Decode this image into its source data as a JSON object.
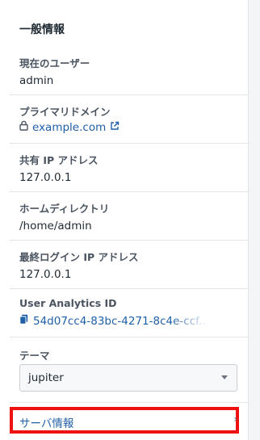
{
  "general": {
    "title": "一般情報",
    "current_user": {
      "label": "現在のユーザー",
      "value": "admin"
    },
    "primary_domain": {
      "label": "プライマリドメイン",
      "value": "example.com"
    },
    "shared_ip": {
      "label": "共有 IP アドレス",
      "value": "127.0.0.1"
    },
    "home_dir": {
      "label": "ホームディレクトリ",
      "value": "/home/admin"
    },
    "last_login_ip": {
      "label": "最終ログイン IP アドレス",
      "value": "127.0.0.1"
    },
    "analytics_id": {
      "label": "User Analytics ID",
      "value": "54d07cc4-83bc-4271-8c4e-ccf..."
    }
  },
  "theme": {
    "label": "テーマ",
    "selected": "jupiter"
  },
  "server_info": {
    "label": "サーバ情報"
  },
  "colors": {
    "link": "#1f5fa8",
    "highlight": "#ee1111"
  }
}
